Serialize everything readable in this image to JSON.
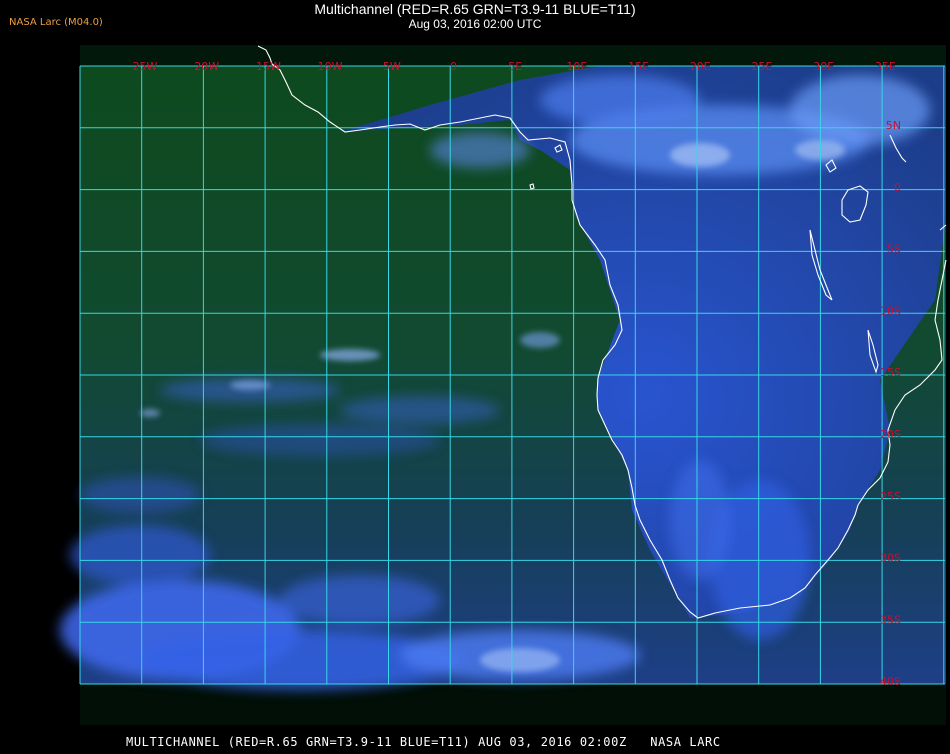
{
  "header": {
    "credit": "NASA Larc (M04.0)",
    "title": "Multichannel (RED=R.65 GRN=T3.9-11 BLUE=T11)",
    "timestamp": "Aug 03, 2016 02:00 UTC"
  },
  "footer": {
    "text": "MULTICHANNEL (RED=R.65 GRN=T3.9-11 BLUE=T11) AUG 03, 2016 02:00Z   NASA LARC"
  },
  "grid": {
    "color": "#36d7e6",
    "label_color": "#c8102e",
    "longitude_labels": [
      "25W",
      "20W",
      "15W",
      "10W",
      "5W",
      "0",
      "5E",
      "10E",
      "15E",
      "20E",
      "25E",
      "30E",
      "35E"
    ],
    "latitude_labels": [
      "5N",
      "0",
      "5S",
      "10S",
      "15S",
      "20S",
      "25S",
      "30S",
      "35S",
      "40S"
    ]
  },
  "colors": {
    "background": "#000000",
    "ocean": "#0f4722",
    "cloud": "#3b67e8",
    "coastline": "#ffffff"
  }
}
